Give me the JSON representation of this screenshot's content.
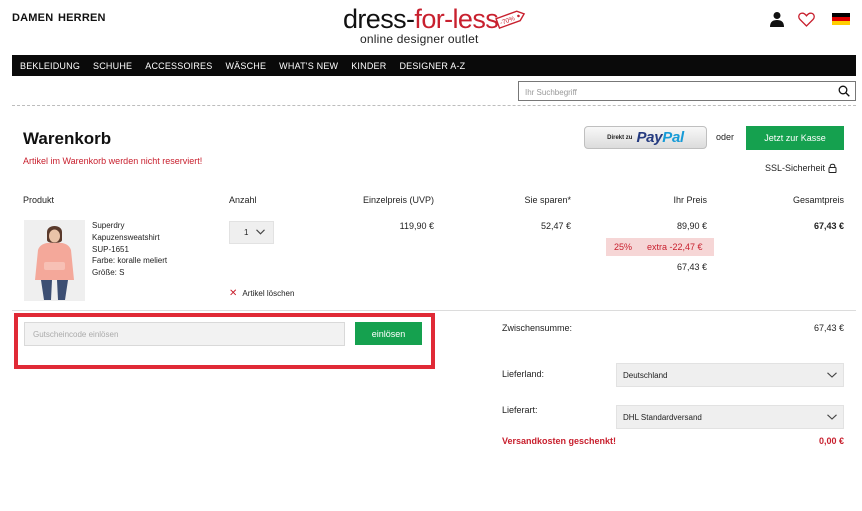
{
  "header": {
    "gender_links": [
      "DAMEN",
      "HERREN"
    ],
    "logo": {
      "part1": "dress-",
      "part2": "for-less",
      "tagline": "online designer outlet",
      "tag_text": "-70%"
    },
    "icons": [
      "user-icon",
      "heart-icon",
      "flag-de-icon"
    ]
  },
  "nav": {
    "items": [
      "BEKLEIDUNG",
      "SCHUHE",
      "ACCESSOIRES",
      "WÄSCHE",
      "WHAT'S NEW",
      "KINDER",
      "DESIGNER A-Z"
    ]
  },
  "search": {
    "placeholder": "Ihr Suchbegriff"
  },
  "cart": {
    "title": "Warenkorb",
    "warning": "Artikel im Warenkorb werden nicht reserviert!",
    "paypal": {
      "small": "Direkt zu",
      "logo1": "Pay",
      "logo2": "Pal"
    },
    "or": "oder",
    "checkout_label": "Jetzt zur Kasse",
    "ssl_label": "SSL-Sicherheit"
  },
  "table": {
    "headers": {
      "product": "Produkt",
      "qty": "Anzahl",
      "unit_price": "Einzelpreis (UVP)",
      "savings": "Sie sparen*",
      "your_price": "Ihr Preis",
      "total": "Gesamtpreis"
    },
    "item": {
      "brand": "Superdry",
      "name": "Kapuzensweatshirt",
      "sku": "SUP-1651",
      "color": "Farbe: koralle meliert",
      "size": "Größe: S",
      "qty": "1",
      "unit_price": "119,90 €",
      "savings": "52,47 €",
      "your_price": "89,90 €",
      "discount_pct": "25%",
      "discount_extra": "extra -22,47 €",
      "final_price": "67,43 €",
      "total": "67,43 €",
      "delete_label": "Artikel löschen"
    }
  },
  "voucher": {
    "placeholder": "Gutscheincode einlösen",
    "button_label": "einlösen"
  },
  "summary": {
    "subtotal_label": "Zwischensumme:",
    "subtotal_value": "67,43 €",
    "country_label": "Lieferland:",
    "country_value": "Deutschland",
    "shipping_label": "Lieferart:",
    "shipping_value": "DHL Standardversand",
    "free_shipping_label": "Versandkosten geschenkt!",
    "free_shipping_value": "0,00 €"
  },
  "colors": {
    "accent_green": "#15a14f",
    "alert_red": "#c8202e",
    "nav_bg": "#0a0a0a",
    "highlight_box": "#e02a36"
  }
}
